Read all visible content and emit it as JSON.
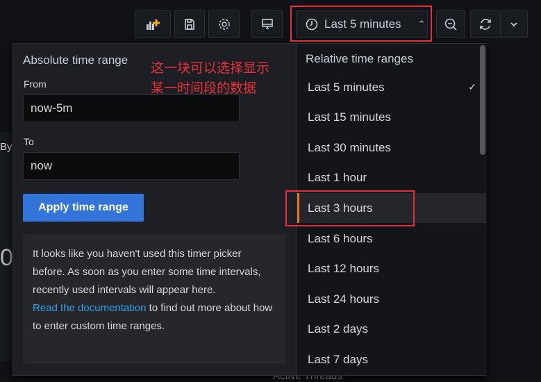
{
  "toolbar": {
    "time_picker_label": "Last 5 minutes",
    "buttons": [
      "add-panel-icon",
      "save-icon",
      "gear-icon",
      "tv-icon",
      "zoom-out-icon",
      "refresh-icon",
      "chevron-down-icon"
    ]
  },
  "background": {
    "panel_fragment_text": "By",
    "stat_fragment": "0",
    "panel_title_fragment": "Active Threads"
  },
  "absolute": {
    "title": "Absolute time range",
    "from_label": "From",
    "from_value": "now-5m",
    "to_label": "To",
    "to_value": "now",
    "apply_label": "Apply time range",
    "info_text": "It looks like you haven't used this timer picker before. As soon as you enter some time intervals, recently used intervals will appear here.",
    "info_link": "Read the documentation",
    "info_tail": " to find out more about how to enter custom time ranges."
  },
  "relative": {
    "title": "Relative time ranges",
    "items": [
      "Last 5 minutes",
      "Last 15 minutes",
      "Last 30 minutes",
      "Last 1 hour",
      "Last 3 hours",
      "Last 6 hours",
      "Last 12 hours",
      "Last 24 hours",
      "Last 2 days",
      "Last 7 days"
    ],
    "checked": "Last 5 minutes",
    "highlighted": "Last 3 hours"
  },
  "annotation": {
    "line1": "这一块可以选择显示",
    "line2": "某一时间段的数据"
  },
  "colors": {
    "accent": "#3274d9",
    "highlight": "#eb7b18",
    "annotation": "#e5303a",
    "link": "#33a2e5"
  }
}
